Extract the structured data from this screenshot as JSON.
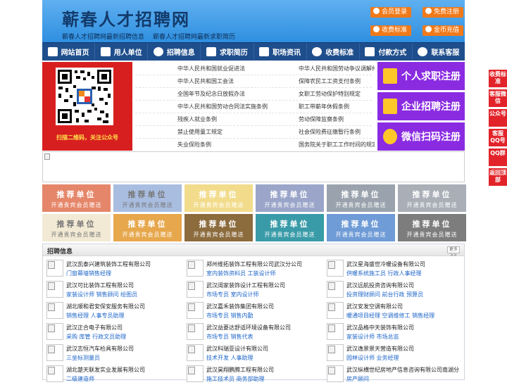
{
  "header": {
    "site_title": "蕲春人才招聘网",
    "slogan_1": "蕲春人才招聘网最新招聘信息",
    "slogan_2": "蕲春人才招聘网最新求职简历",
    "buttons": [
      "会员登录",
      "免费注册",
      "收费标准",
      "金币充值"
    ]
  },
  "nav": {
    "items": [
      "网站首页",
      "用人单位",
      "招聘信息",
      "求职简历",
      "职场资讯",
      "收费标准",
      "付款方式",
      "联系客服"
    ]
  },
  "qr": {
    "caption": "扫描二维码，关注公众号"
  },
  "laws": {
    "left": [
      "中华人民共和国就业促进法",
      "中华人民共和国工会法",
      "全国年节及纪念日放假办法",
      "中华人民共和国劳动合同法实施条例",
      "残疾人就业条例",
      "禁止使用童工规定",
      "失业保险条例"
    ],
    "right": [
      "中华人民共和国劳动争议调解仲裁法",
      "保障农民工工资支付条例",
      "女职工劳动保护特别规定",
      "职工带薪年休假条例",
      "劳动保障监察条例",
      "社会保险费征缴暂行条例",
      "国务院关于职工工作时间的规定"
    ]
  },
  "register": [
    "个人求职注册",
    "企业招聘注册",
    "微信扫码注册"
  ],
  "recommend": {
    "title": "推荐单位",
    "subtitle": "开通贵宾会员赠送"
  },
  "jobs": {
    "section_title": "招聘信息",
    "more_label": "更多>>",
    "items": [
      {
        "company": "武汉凯泰兴建筑装饰工程有限公司",
        "positions": "门窗幕墙销售经理"
      },
      {
        "company": "郑州维拓装饰工程有限公司武汉分公司",
        "positions": "室内装饰资料员 工装设计师"
      },
      {
        "company": "武汉星海盛世冷暖设备有限公司",
        "positions": "供暖系统施工员 行政人事经理"
      },
      {
        "company": "武汉可比装饰工程有限公司",
        "positions": "家装设计师 销售顾问 绘图员"
      },
      {
        "company": "武汉阔家装饰设计工程有限公司",
        "positions": "市场专员 室内设计师"
      },
      {
        "company": "武汉远航投资咨询有限公司",
        "positions": "投资理财顾问 前台行政 预算员"
      },
      {
        "company": "湖北顺和君安保安服务有限公司",
        "positions": "销售经理 人事专员助理"
      },
      {
        "company": "武汉嘉禾装饰集团有限公司",
        "positions": "市场专员 销售内勤"
      },
      {
        "company": "武汉安发空调有限公司",
        "positions": "暖通项目经理 空调维修工 销售经理"
      },
      {
        "company": "武汉正合电子有限公司",
        "positions": "采购 库管 行政文员助理"
      },
      {
        "company": "武汉益菱达舒适环境设备有限公司",
        "positions": "市场专员 销售代表"
      },
      {
        "company": "武汉品格中天装饰有限公司",
        "positions": "家装设计师 市场总监"
      },
      {
        "company": "武汉志恒汽车检具有限公司",
        "positions": "三坐标测量员"
      },
      {
        "company": "武汉科瑞亚设计有限公司",
        "positions": "技术开发 人事助理"
      },
      {
        "company": "武汉逸景景天营造有限公司",
        "positions": "园林设计师 业务经理"
      },
      {
        "company": "湖北楚天联发实业发展有限公司",
        "positions": "二级建造师"
      },
      {
        "company": "武汉昊翔鹏腾工程有限公司",
        "positions": "施工技术员 商务部助理"
      },
      {
        "company": "武汉纵横世纪房地产信息咨询有限公司南湖分",
        "positions": "房产顾问"
      }
    ]
  },
  "sidebar": [
    "收费标准",
    "客服微信",
    "公众号",
    "客服QQ号",
    "QQ群",
    "返回顶部"
  ],
  "colors": {
    "tiles": [
      "#e5866a",
      "#a9bde0",
      "#f2dc8c",
      "#9aa5c9",
      "#9aa3ad",
      "#a9aeb7",
      "#f2ead4",
      "#e7a74c",
      "#8c6b3d",
      "#3a9ba8",
      "#6f9bd6",
      "#7d7d7d"
    ],
    "tile_text": [
      "#ffffff",
      "#777777",
      "#ffffff",
      "#ffffff",
      "#ffffff",
      "#ffffff",
      "#777777",
      "#ffffff",
      "#ffffff",
      "#ffffff",
      "#ffffff",
      "#ffffff"
    ]
  }
}
